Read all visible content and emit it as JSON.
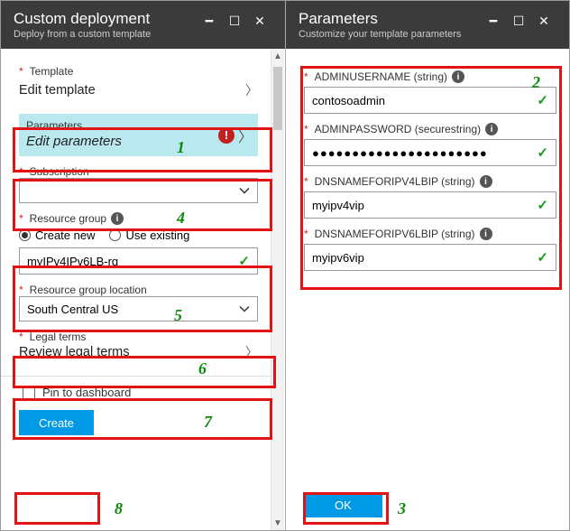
{
  "left": {
    "title": "Custom deployment",
    "subtitle": "Deploy from a custom template",
    "template_label": "Template",
    "template_value": "Edit template",
    "parameters_label": "Parameters",
    "parameters_value": "Edit parameters",
    "subscription_label": "Subscription",
    "subscription_value": "",
    "resource_group_label": "Resource group",
    "rg_create_new": "Create new",
    "rg_use_existing": "Use existing",
    "rg_name": "myIPv4IPv6LB-rg",
    "rg_location_label": "Resource group location",
    "rg_location_value": "South Central US",
    "legal_label": "Legal terms",
    "legal_value": "Review legal terms",
    "pin_label": "Pin to dashboard",
    "create_btn": "Create"
  },
  "right": {
    "title": "Parameters",
    "subtitle": "Customize your template parameters",
    "p1_label": "ADMINUSERNAME (string)",
    "p1_value": "contosoadmin",
    "p2_label": "ADMINPASSWORD (securestring)",
    "p2_value": "●●●●●●●●●●●●●●●●●●●●●●",
    "p3_label": "DNSNAMEFORIPV4LBIP (string)",
    "p3_value": "myipv4vip",
    "p4_label": "DNSNAMEFORIPV6LBIP (string)",
    "p4_value": "myipv6vip",
    "ok_btn": "OK"
  },
  "annotations": {
    "n1": "1",
    "n2": "2",
    "n3": "3",
    "n4": "4",
    "n5": "5",
    "n6": "6",
    "n7": "7",
    "n8": "8"
  }
}
